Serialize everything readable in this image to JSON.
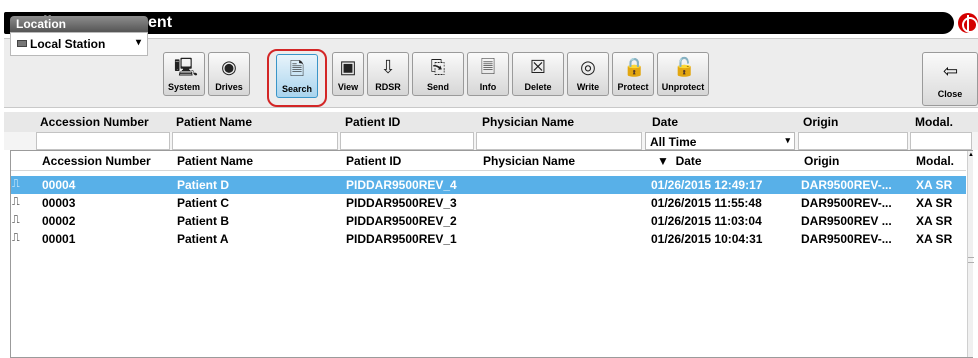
{
  "window": {
    "title": "Studies Management"
  },
  "location": {
    "label": "Location",
    "selected": "Local Station"
  },
  "toolbar": {
    "buttons": [
      {
        "label": "System",
        "icon": "computer-icon"
      },
      {
        "label": "Drives",
        "icon": "disc-icon"
      },
      {
        "label": "Search",
        "icon": "search-document-icon",
        "active": true
      },
      {
        "label": "View",
        "icon": "film-icon"
      },
      {
        "label": "RDSR",
        "icon": "report-download-icon"
      },
      {
        "label": "Send",
        "icon": "send-documents-icon"
      },
      {
        "label": "Info",
        "icon": "info-document-icon"
      },
      {
        "label": "Delete",
        "icon": "delete-icon"
      },
      {
        "label": "Write",
        "icon": "write-disc-icon"
      },
      {
        "label": "Protect",
        "icon": "lock-icon"
      },
      {
        "label": "Unprotect",
        "icon": "unlock-icon"
      }
    ],
    "close_label": "Close"
  },
  "filters": {
    "headers": [
      "Accession Number",
      "Patient Name",
      "Patient ID",
      "Physician Name",
      "Date",
      "Origin",
      "Modal."
    ],
    "date_selected": "All Time"
  },
  "table": {
    "columns": [
      "Accession Number",
      "Patient Name",
      "Patient ID",
      "Physician Name",
      "Date",
      "Origin",
      "Modal."
    ],
    "sort_indicator": "▼",
    "rows": [
      {
        "accession": "00004",
        "patient_name": "Patient D",
        "patient_id": "PIDDAR9500REV_4",
        "physician": "",
        "date": "01/26/2015 12:49:17",
        "origin": "DAR9500REV-...",
        "modal": "XA SR",
        "selected": true
      },
      {
        "accession": "00003",
        "patient_name": "Patient C",
        "patient_id": "PIDDAR9500REV_3",
        "physician": "",
        "date": "01/26/2015 11:55:48",
        "origin": "DAR9500REV-...",
        "modal": "XA SR",
        "selected": false
      },
      {
        "accession": "00002",
        "patient_name": "Patient B",
        "patient_id": "PIDDAR9500REV_2",
        "physician": "",
        "date": "01/26/2015 11:03:04",
        "origin": "DAR9500REV ...",
        "modal": "XA SR",
        "selected": false
      },
      {
        "accession": "00001",
        "patient_name": "Patient A",
        "patient_id": "PIDDAR9500REV_1",
        "physician": "",
        "date": "01/26/2015 10:04:31",
        "origin": "DAR9500REV-...",
        "modal": "XA SR",
        "selected": false
      }
    ]
  },
  "colors": {
    "selection": "#58b0e8",
    "highlight": "#d32626",
    "titlebar": "#000000",
    "brand": "#d40000"
  }
}
